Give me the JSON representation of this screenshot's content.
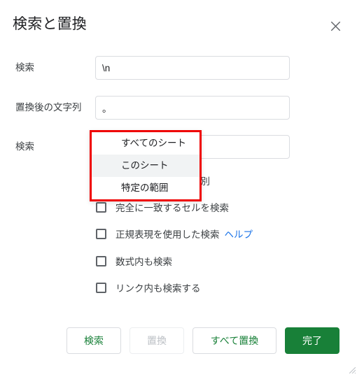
{
  "dialog": {
    "title": "検索と置換",
    "close_icon": "close-icon"
  },
  "fields": {
    "search": {
      "label": "検索",
      "value": "\\n",
      "placeholder": ""
    },
    "replace": {
      "label": "置換後の文字列",
      "value": "。",
      "placeholder": ""
    },
    "scope": {
      "label": "検索",
      "selected": "このシート"
    }
  },
  "dropdown": {
    "open": true,
    "border_color": "#ef0000",
    "highlight_color": "#f1f3f4",
    "items": [
      {
        "label": "すべてのシート",
        "selected": false
      },
      {
        "label": "このシート",
        "selected": true
      },
      {
        "label": "特定の範囲",
        "selected": false
      }
    ]
  },
  "checkboxes": [
    {
      "label": "大文字と小文字を区別",
      "checked": false
    },
    {
      "label": "完全に一致するセルを検索",
      "checked": false
    },
    {
      "label": "正規表現を使用した検索",
      "checked": false,
      "link": "ヘルプ"
    },
    {
      "label": "数式内も検索",
      "checked": false
    },
    {
      "label": "リンク内も検索する",
      "checked": false
    }
  ],
  "buttons": {
    "find": "検索",
    "replace": "置換",
    "replace_all": "すべて置換",
    "done": "完了"
  },
  "colors": {
    "accent_green": "#188038",
    "link_blue": "#1a73e8",
    "annotation_red": "#ef0000",
    "border_gray": "#dadce0"
  }
}
